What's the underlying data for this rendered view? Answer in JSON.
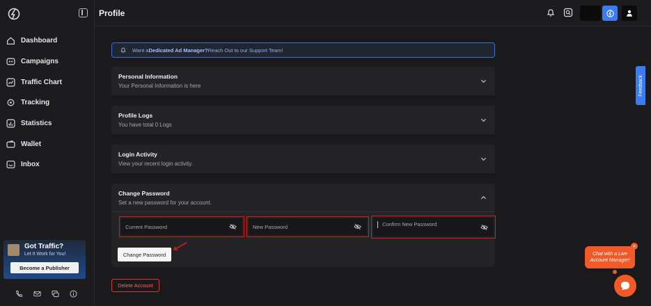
{
  "sidebar": {
    "items": [
      {
        "label": "Dashboard",
        "icon": "home-icon"
      },
      {
        "label": "Campaigns",
        "icon": "campaign-icon"
      },
      {
        "label": "Traffic Chart",
        "icon": "chart-icon"
      },
      {
        "label": "Tracking",
        "icon": "tracking-icon"
      },
      {
        "label": "Statistics",
        "icon": "statistics-icon"
      },
      {
        "label": "Wallet",
        "icon": "wallet-icon"
      },
      {
        "label": "Inbox",
        "icon": "inbox-icon"
      }
    ],
    "promo": {
      "title": "Got Traffic?",
      "subtitle": "Let It Work for You!",
      "button": "Become a Publisher"
    }
  },
  "header": {
    "title": "Profile"
  },
  "banner": {
    "prefix": "Want a ",
    "highlight": "Dedicated Ad Manager?",
    "suffix": " Reach Out to our Support Team!"
  },
  "cards": [
    {
      "title": "Personal Information",
      "subtitle": "Your Personal Information is here"
    },
    {
      "title": "Profile Logs",
      "subtitle": "You have total 0 Logs"
    },
    {
      "title": "Login Activity",
      "subtitle": "View your recent login activity."
    },
    {
      "title": "Change Password",
      "subtitle": "Set a new password for your account."
    }
  ],
  "password": {
    "current_placeholder": "Current Password",
    "new_placeholder": "New Password",
    "confirm_placeholder": "Confirm New Password",
    "submit": "Change Password"
  },
  "delete_account": "Delete Account",
  "feedback": "Feedback",
  "chat": {
    "bubble": "Chat with a Live Account Manager!"
  },
  "colors": {
    "accent": "#3b7cf2",
    "danger": "#d21c1c",
    "chat": "#f05a28",
    "background": "#1a1a1c"
  }
}
